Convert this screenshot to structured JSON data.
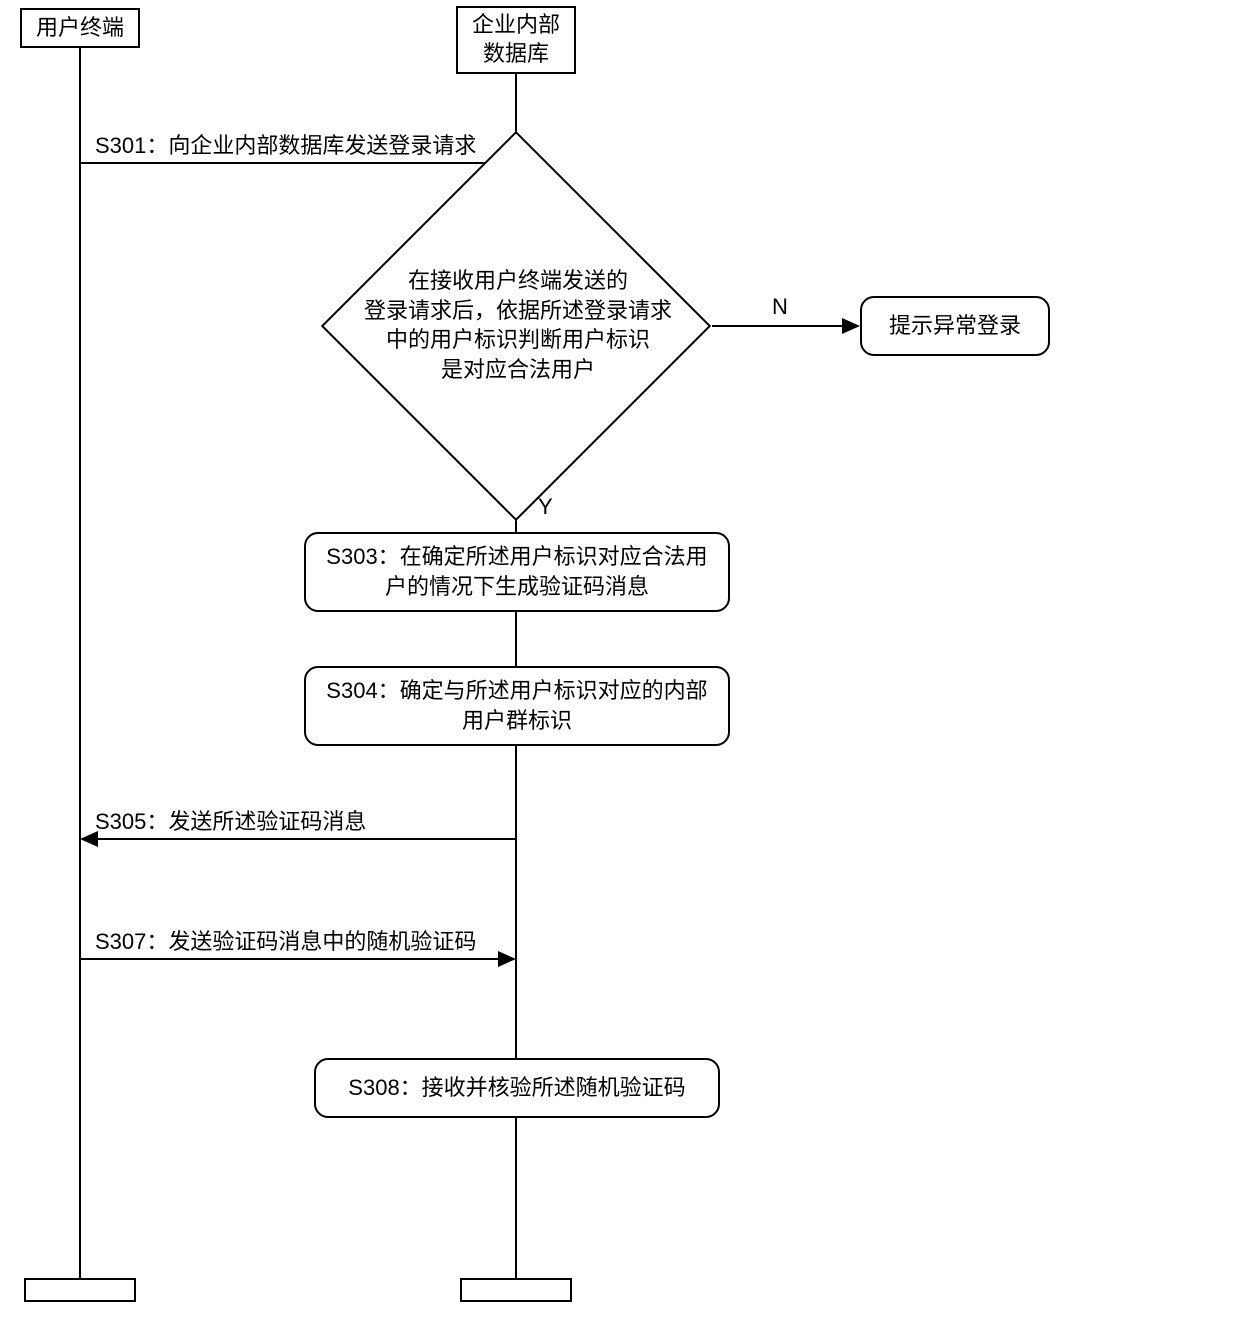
{
  "actors": {
    "user_terminal": "用户终端",
    "enterprise_db_line1": "企业内部",
    "enterprise_db_line2": "数据库"
  },
  "messages": {
    "s301": "S301：向企业内部数据库发送登录请求",
    "s305": "S305：发送所述验证码消息",
    "s307": "S307：发送验证码消息中的随机验证码"
  },
  "decision": {
    "text": "在接收用户终端发送的\n登录请求后，依据所述登录请求\n中的用户标识判断用户标识\n是对应合法用户",
    "yes": "Y",
    "no": "N"
  },
  "steps": {
    "alert": "提示异常登录",
    "s303": "S303：在确定所述用户标识对应合法用\n户的情况下生成验证码消息",
    "s304": "S304：确定与所述用户标识对应的内部\n用户群标识",
    "s308": "S308：接收并核验所述随机验证码"
  }
}
